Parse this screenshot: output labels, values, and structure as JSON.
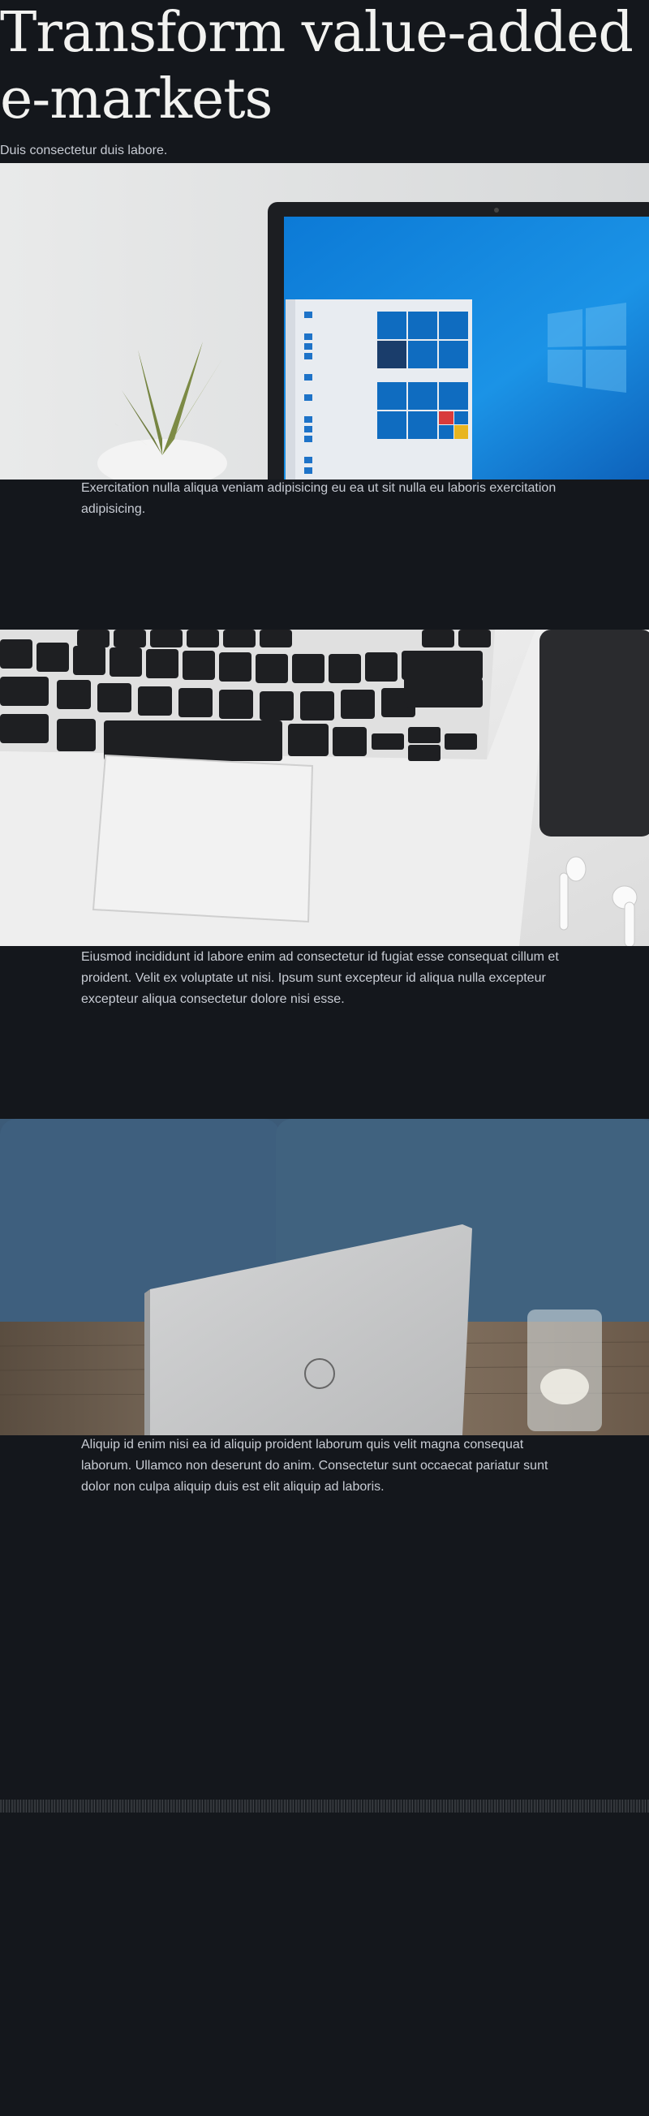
{
  "hero": {
    "title": "Transform value-added e-markets",
    "subtitle": "Duis consectetur duis labore."
  },
  "sections": [
    {
      "image_icon": "laptop-windows-desktop-photo",
      "caption": "Exercitation nulla aliqua veniam adipisicing eu ea ut sit nulla eu laboris exercitation adipisicing."
    },
    {
      "image_icon": "macbook-keyboard-airpods-photo",
      "caption": "Eiusmod incididunt id labore enim ad consectetur id fugiat esse consequat cillum et proident. Velit ex voluptate ut nisi. Ipsum sunt excepteur id aliqua nulla excepteur excepteur aliqua consectetur dolore nisi esse."
    },
    {
      "image_icon": "dell-laptop-on-table-photo",
      "caption": "Aliquip id enim nisi ea id aliquip proident laborum quis velit magna consequat laborum. Ullamco non deserunt do anim. Consectetur sunt occaecat pariatur sunt dolor non culpa aliquip duis est elit aliquip ad laboris."
    }
  ],
  "colors": {
    "background": "#14171c",
    "title": "#f2f2f0",
    "text": "#c8ccd4"
  }
}
